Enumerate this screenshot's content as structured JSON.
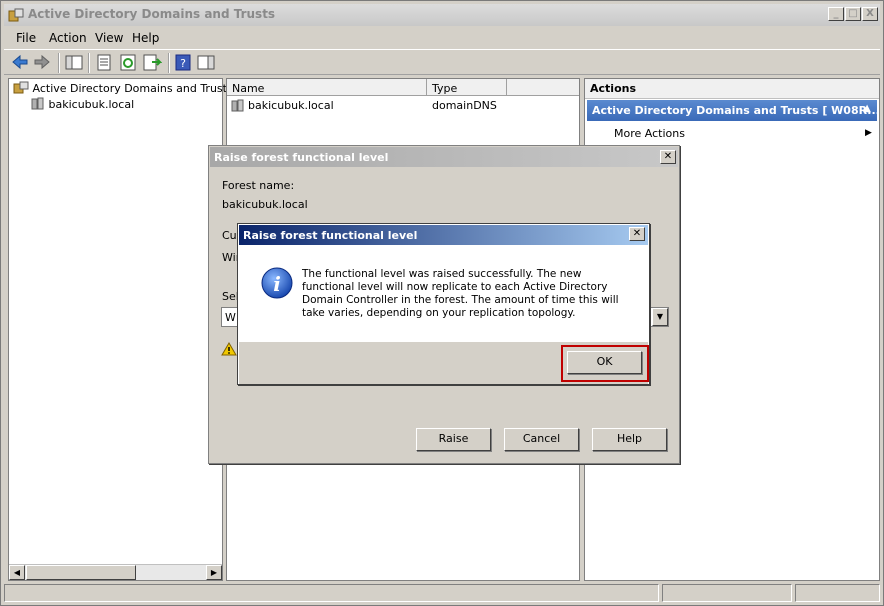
{
  "window": {
    "title": "Active Directory Domains and Trusts",
    "controls": {
      "minimize": "_",
      "maximize": "□",
      "close": "X"
    }
  },
  "menu": [
    "File",
    "Action",
    "View",
    "Help"
  ],
  "tree": {
    "root_label": "Active Directory Domains and Trusts [ W",
    "child_label": "bakicubuk.local"
  },
  "list": {
    "columns": [
      "Name",
      "Type"
    ],
    "rows": [
      {
        "name": "bakicubuk.local",
        "type": "domainDNS"
      }
    ]
  },
  "actions": {
    "header": "Actions",
    "group": "Active Directory Domains and Trusts [ W08R...",
    "more_actions": "More Actions"
  },
  "raise_dialog": {
    "title": "Raise forest functional level",
    "forest_name_label": "Forest name:",
    "forest_name_value": "bakicubuk.local",
    "current_label_partial": "Cur",
    "current_value_partial": "Wir",
    "select_label_partial": "Sel",
    "select_value_partial": "W",
    "buttons": {
      "raise": "Raise",
      "cancel": "Cancel",
      "help": "Help"
    }
  },
  "message_dialog": {
    "title": "Raise forest functional level",
    "message": "The functional level was raised successfully. The new functional level will now replicate to each Active Directory Domain Controller in the forest. The amount of time this will take varies, depending on your replication topology.",
    "ok_label": "OK"
  },
  "colors": {
    "highlight": "#c00000",
    "titlebar_active": "#0a246a",
    "actions_group": "#3a6ab8"
  }
}
